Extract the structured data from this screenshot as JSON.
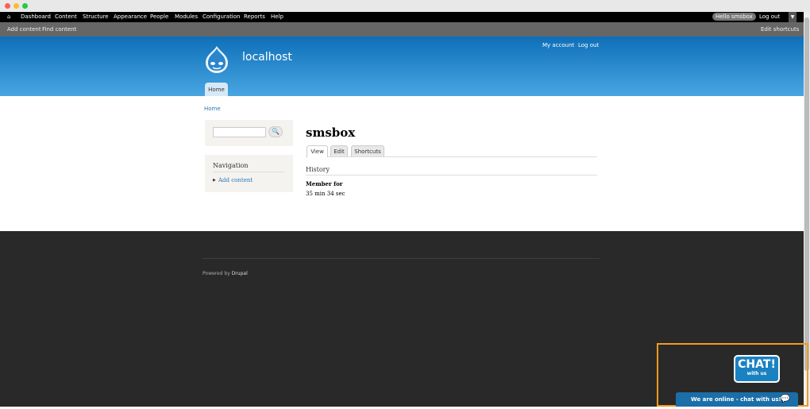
{
  "toolbar": {
    "items": [
      "Dashboard",
      "Content",
      "Structure",
      "Appearance",
      "People",
      "Modules",
      "Configuration",
      "Reports",
      "Help"
    ],
    "hello": "Hello smsbox",
    "logout": "Log out"
  },
  "shortcuts": {
    "add": "Add content",
    "find": "Find content",
    "edit": "Edit shortcuts"
  },
  "header": {
    "site_name": "localhost",
    "my_account": "My account",
    "logout": "Log out",
    "home_tab": "Home"
  },
  "breadcrumb": "Home",
  "sidebar": {
    "search_button": "🔍",
    "nav_title": "Navigation",
    "nav_item": "Add content"
  },
  "main": {
    "title": "smsbox",
    "tabs": [
      "View",
      "Edit",
      "Shortcuts"
    ],
    "history": "History",
    "member_for": "Member for",
    "duration": "35 min 34 sec"
  },
  "footer": {
    "powered": "Powered by ",
    "drupal": "Drupal"
  },
  "chat": {
    "logo_big": "CHAT!",
    "logo_small": "with us",
    "bar": "We are online - chat with us!"
  },
  "colors": {
    "accent": "#0e6fb8",
    "highlight": "#f39a1e"
  }
}
